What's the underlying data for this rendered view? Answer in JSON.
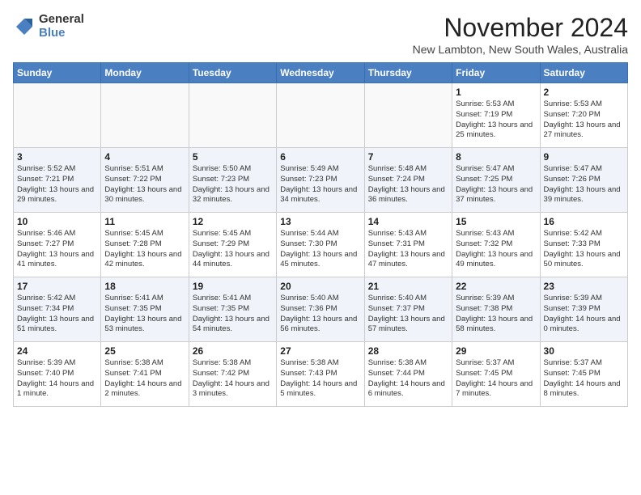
{
  "logo": {
    "general": "General",
    "blue": "Blue"
  },
  "title": "November 2024",
  "location": "New Lambton, New South Wales, Australia",
  "days_of_week": [
    "Sunday",
    "Monday",
    "Tuesday",
    "Wednesday",
    "Thursday",
    "Friday",
    "Saturday"
  ],
  "weeks": [
    [
      {
        "day": "",
        "info": ""
      },
      {
        "day": "",
        "info": ""
      },
      {
        "day": "",
        "info": ""
      },
      {
        "day": "",
        "info": ""
      },
      {
        "day": "",
        "info": ""
      },
      {
        "day": "1",
        "info": "Sunrise: 5:53 AM\nSunset: 7:19 PM\nDaylight: 13 hours and 25 minutes."
      },
      {
        "day": "2",
        "info": "Sunrise: 5:53 AM\nSunset: 7:20 PM\nDaylight: 13 hours and 27 minutes."
      }
    ],
    [
      {
        "day": "3",
        "info": "Sunrise: 5:52 AM\nSunset: 7:21 PM\nDaylight: 13 hours and 29 minutes."
      },
      {
        "day": "4",
        "info": "Sunrise: 5:51 AM\nSunset: 7:22 PM\nDaylight: 13 hours and 30 minutes."
      },
      {
        "day": "5",
        "info": "Sunrise: 5:50 AM\nSunset: 7:23 PM\nDaylight: 13 hours and 32 minutes."
      },
      {
        "day": "6",
        "info": "Sunrise: 5:49 AM\nSunset: 7:23 PM\nDaylight: 13 hours and 34 minutes."
      },
      {
        "day": "7",
        "info": "Sunrise: 5:48 AM\nSunset: 7:24 PM\nDaylight: 13 hours and 36 minutes."
      },
      {
        "day": "8",
        "info": "Sunrise: 5:47 AM\nSunset: 7:25 PM\nDaylight: 13 hours and 37 minutes."
      },
      {
        "day": "9",
        "info": "Sunrise: 5:47 AM\nSunset: 7:26 PM\nDaylight: 13 hours and 39 minutes."
      }
    ],
    [
      {
        "day": "10",
        "info": "Sunrise: 5:46 AM\nSunset: 7:27 PM\nDaylight: 13 hours and 41 minutes."
      },
      {
        "day": "11",
        "info": "Sunrise: 5:45 AM\nSunset: 7:28 PM\nDaylight: 13 hours and 42 minutes."
      },
      {
        "day": "12",
        "info": "Sunrise: 5:45 AM\nSunset: 7:29 PM\nDaylight: 13 hours and 44 minutes."
      },
      {
        "day": "13",
        "info": "Sunrise: 5:44 AM\nSunset: 7:30 PM\nDaylight: 13 hours and 45 minutes."
      },
      {
        "day": "14",
        "info": "Sunrise: 5:43 AM\nSunset: 7:31 PM\nDaylight: 13 hours and 47 minutes."
      },
      {
        "day": "15",
        "info": "Sunrise: 5:43 AM\nSunset: 7:32 PM\nDaylight: 13 hours and 49 minutes."
      },
      {
        "day": "16",
        "info": "Sunrise: 5:42 AM\nSunset: 7:33 PM\nDaylight: 13 hours and 50 minutes."
      }
    ],
    [
      {
        "day": "17",
        "info": "Sunrise: 5:42 AM\nSunset: 7:34 PM\nDaylight: 13 hours and 51 minutes."
      },
      {
        "day": "18",
        "info": "Sunrise: 5:41 AM\nSunset: 7:35 PM\nDaylight: 13 hours and 53 minutes."
      },
      {
        "day": "19",
        "info": "Sunrise: 5:41 AM\nSunset: 7:35 PM\nDaylight: 13 hours and 54 minutes."
      },
      {
        "day": "20",
        "info": "Sunrise: 5:40 AM\nSunset: 7:36 PM\nDaylight: 13 hours and 56 minutes."
      },
      {
        "day": "21",
        "info": "Sunrise: 5:40 AM\nSunset: 7:37 PM\nDaylight: 13 hours and 57 minutes."
      },
      {
        "day": "22",
        "info": "Sunrise: 5:39 AM\nSunset: 7:38 PM\nDaylight: 13 hours and 58 minutes."
      },
      {
        "day": "23",
        "info": "Sunrise: 5:39 AM\nSunset: 7:39 PM\nDaylight: 14 hours and 0 minutes."
      }
    ],
    [
      {
        "day": "24",
        "info": "Sunrise: 5:39 AM\nSunset: 7:40 PM\nDaylight: 14 hours and 1 minute."
      },
      {
        "day": "25",
        "info": "Sunrise: 5:38 AM\nSunset: 7:41 PM\nDaylight: 14 hours and 2 minutes."
      },
      {
        "day": "26",
        "info": "Sunrise: 5:38 AM\nSunset: 7:42 PM\nDaylight: 14 hours and 3 minutes."
      },
      {
        "day": "27",
        "info": "Sunrise: 5:38 AM\nSunset: 7:43 PM\nDaylight: 14 hours and 5 minutes."
      },
      {
        "day": "28",
        "info": "Sunrise: 5:38 AM\nSunset: 7:44 PM\nDaylight: 14 hours and 6 minutes."
      },
      {
        "day": "29",
        "info": "Sunrise: 5:37 AM\nSunset: 7:45 PM\nDaylight: 14 hours and 7 minutes."
      },
      {
        "day": "30",
        "info": "Sunrise: 5:37 AM\nSunset: 7:45 PM\nDaylight: 14 hours and 8 minutes."
      }
    ]
  ]
}
